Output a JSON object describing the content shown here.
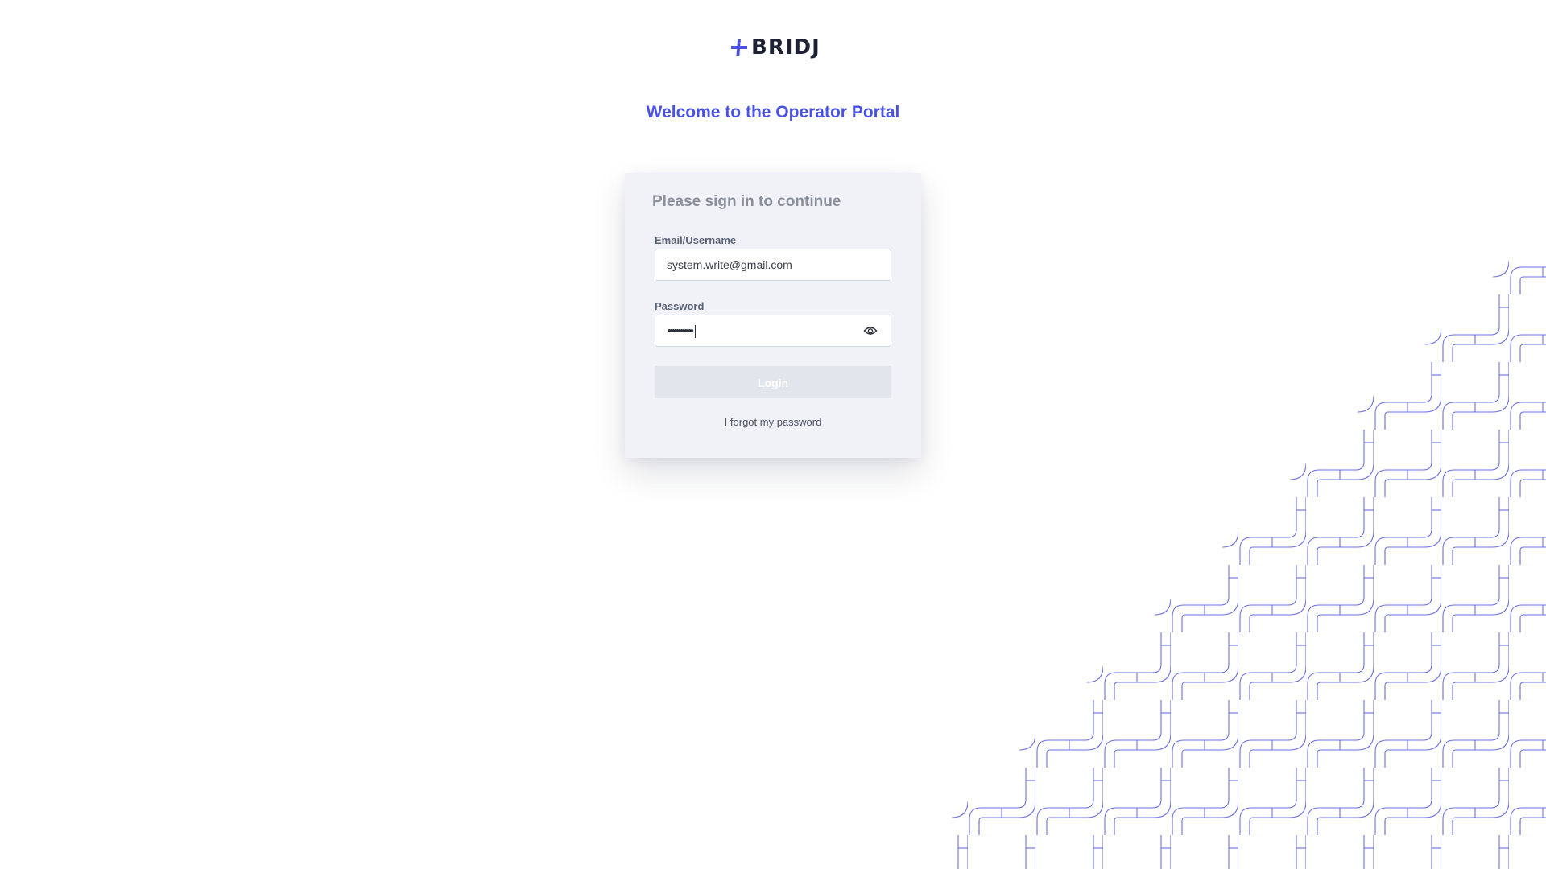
{
  "brand": {
    "name": "BRIDJ",
    "logo_icon": "plus-mark-icon",
    "accent_color": "#4a52e4"
  },
  "welcome": {
    "title": "Welcome to the Operator Portal"
  },
  "login_card": {
    "title": "Please sign in to continue",
    "email_label": "Email/Username",
    "email_value": "system.write@gmail.com",
    "password_label": "Password",
    "password_mask": "••••••••••••",
    "password_toggle_icon": "eye-icon",
    "login_label": "Login",
    "forgot_label": "I forgot my password"
  },
  "background": {
    "pattern_icon": "pipe-grid-pattern",
    "pattern_color": "#6a70e0"
  }
}
